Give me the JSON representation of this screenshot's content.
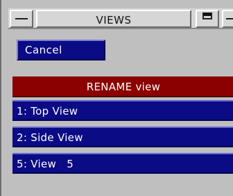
{
  "window": {
    "title": "VIEWS"
  },
  "cancel_label": "Cancel",
  "menu": {
    "header": "RENAME view",
    "items": [
      {
        "label": "1: Top View"
      },
      {
        "label": "2: Side View"
      },
      {
        "label": "5: View   5"
      }
    ]
  },
  "colors": {
    "panel_bg": "#bfbfbf",
    "button_blue": "#0b0b86",
    "header_red": "#8b0000",
    "text_white": "#ffffff"
  }
}
